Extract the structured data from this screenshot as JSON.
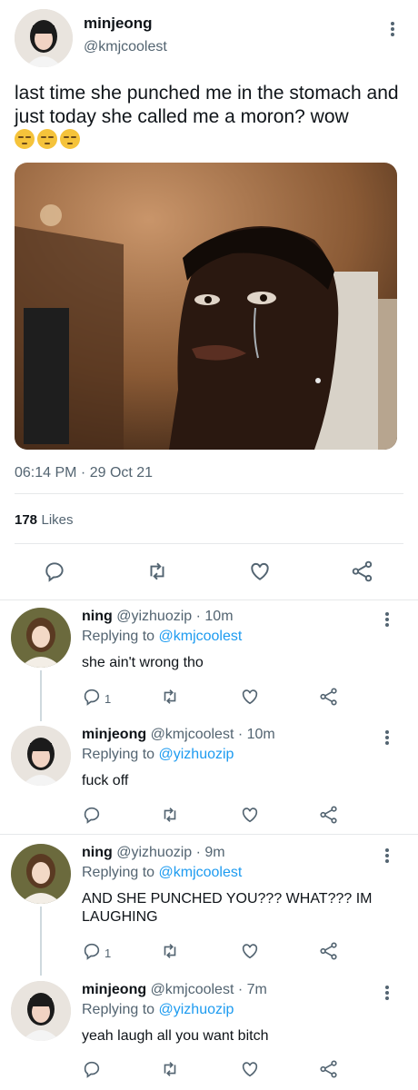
{
  "main_tweet": {
    "name": "minjeong",
    "handle": "@kmjcoolest",
    "text": "last time she punched me in the stomach and just today she called me a moron? wow",
    "emoji": [
      "pensive-face",
      "pensive-face",
      "pensive-face"
    ],
    "time": "06:14 PM",
    "date": "29 Oct 21",
    "likes_count": "178",
    "likes_label": "Likes"
  },
  "replies": [
    {
      "name": "ning",
      "handle": "@yizhuozip",
      "time": "10m",
      "replying_label": "Replying to",
      "replying_to": "@kmjcoolest",
      "text": "she ain't wrong tho",
      "reply_count": "1"
    },
    {
      "name": "minjeong",
      "handle": "@kmjcoolest",
      "time": "10m",
      "replying_label": "Replying to",
      "replying_to": "@yizhuozip",
      "text": "fuck off",
      "reply_count": ""
    },
    {
      "name": "ning",
      "handle": "@yizhuozip",
      "time": "9m",
      "replying_label": "Replying to",
      "replying_to": "@kmjcoolest",
      "text": "AND SHE PUNCHED YOU??? WHAT??? IM LAUGHING",
      "reply_count": "1"
    },
    {
      "name": "minjeong",
      "handle": "@kmjcoolest",
      "time": "7m",
      "replying_label": "Replying to",
      "replying_to": "@yizhuozip",
      "text": "yeah laugh all you want bitch",
      "reply_count": ""
    }
  ],
  "colors": {
    "accent": "#1d9bf0",
    "secondary_text": "#536471",
    "divider": "#e6e8ea"
  }
}
